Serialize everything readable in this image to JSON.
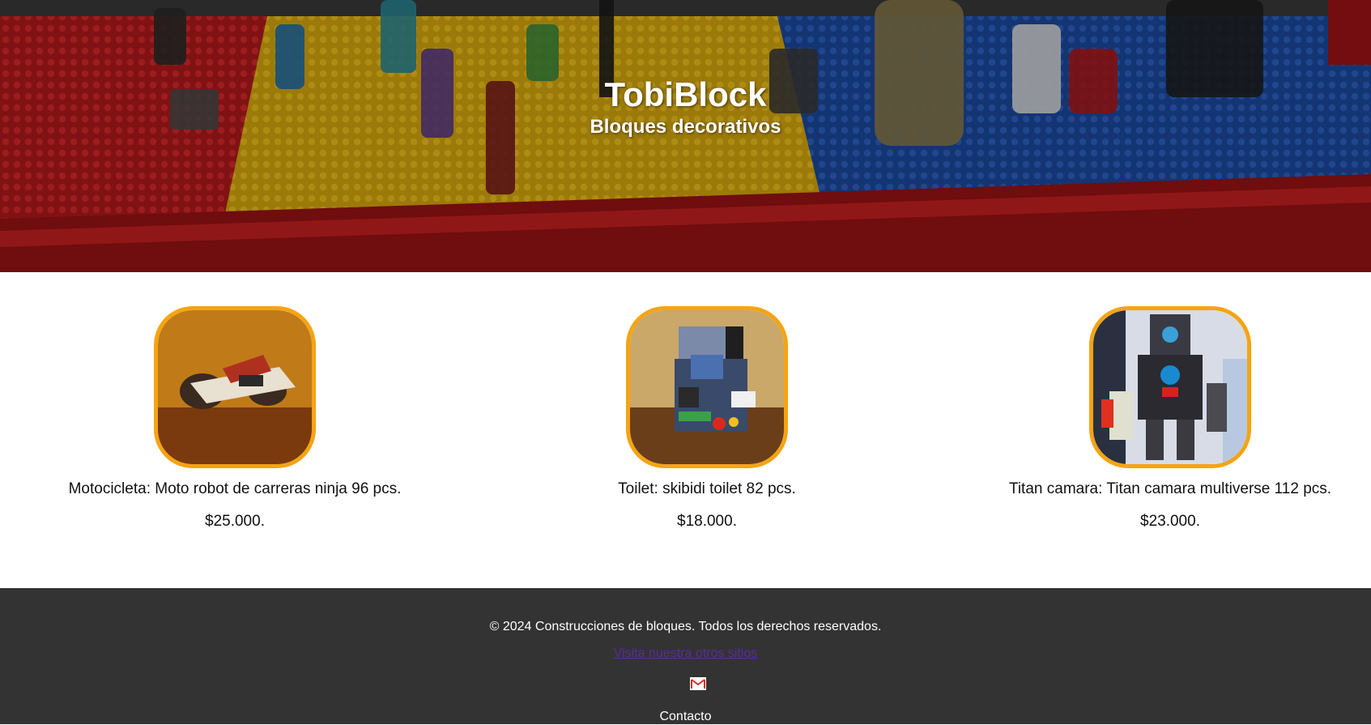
{
  "header": {
    "title": "TobiBlock",
    "subtitle": "Bloques decorativos"
  },
  "products": [
    {
      "name": "Motocicleta: Moto robot de carreras ninja 96 pcs.",
      "price": "$25.000."
    },
    {
      "name": "Toilet: skibidi toilet 82 pcs.",
      "price": "$18.000."
    },
    {
      "name": "Titan camara: Titan camara multiverse 112 pcs.",
      "price": "$23.000."
    }
  ],
  "footer": {
    "copyright": "© 2024 Construcciones de bloques. Todos los derechos reservados.",
    "link_text": "Visita nuestra otros sitios",
    "contact": "Contacto"
  },
  "colors": {
    "accent_border": "#f5a412",
    "footer_bg": "#333333",
    "link": "#5a2ba0"
  }
}
